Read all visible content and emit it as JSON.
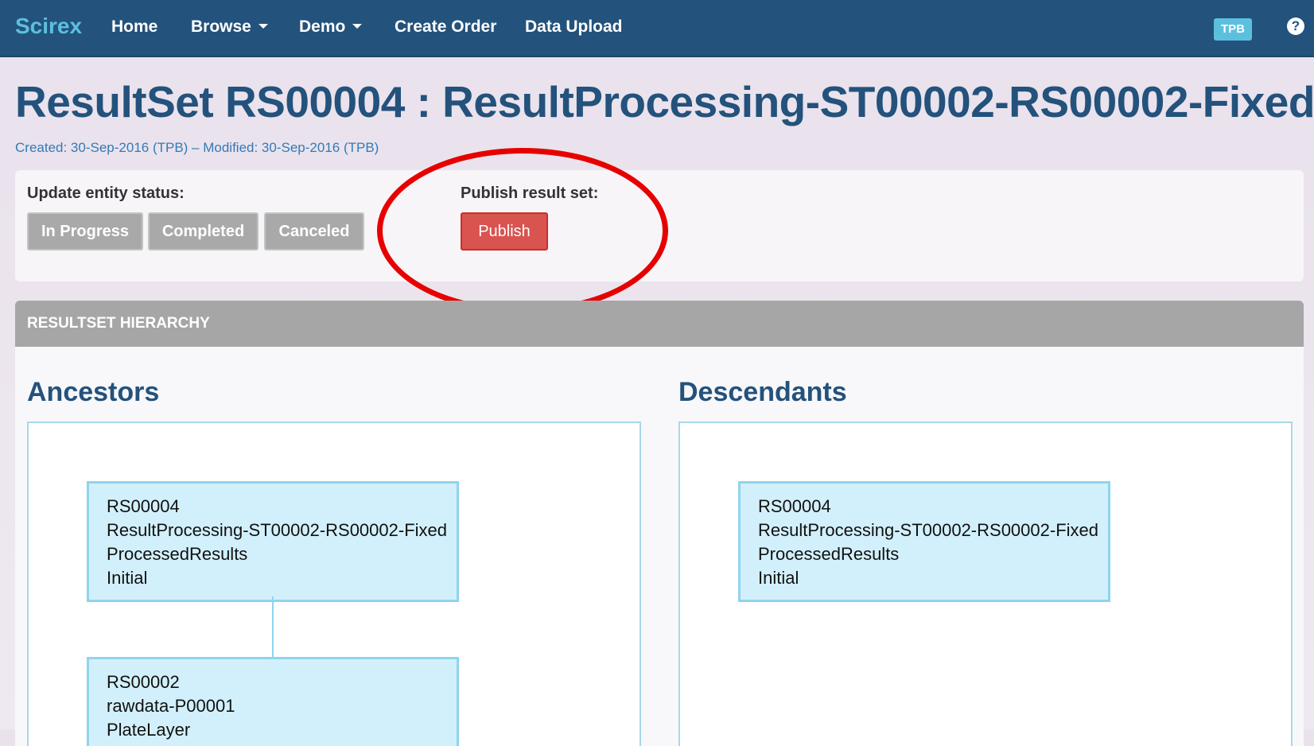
{
  "navbar": {
    "brand": "Scirex",
    "items": [
      {
        "label": "Home"
      },
      {
        "label": "Browse"
      },
      {
        "label": "Demo"
      },
      {
        "label": "Create Order"
      },
      {
        "label": "Data Upload"
      }
    ],
    "user_badge": "TPB",
    "help_glyph": "?"
  },
  "page": {
    "title": "ResultSet RS00004 : ResultProcessing-ST00002-RS00002-Fixed",
    "meta": "Created: 30-Sep-2016 (TPB) – Modified: 30-Sep-2016 (TPB)"
  },
  "status_panel": {
    "update_label": "Update entity status:",
    "buttons": [
      "In Progress",
      "Completed",
      "Canceled"
    ],
    "publish_label": "Publish result set:",
    "publish_button": "Publish"
  },
  "hierarchy": {
    "header": "RESULTSET HIERARCHY",
    "ancestors_title": "Ancestors",
    "descendants_title": "Descendants",
    "ancestors": [
      {
        "id": "RS00004",
        "name": "ResultProcessing-ST00002-RS00002-Fixed",
        "type": "ProcessedResults",
        "status": "Initial"
      },
      {
        "id": "RS00002",
        "name": "rawdata-P00001",
        "type": "PlateLayer",
        "status": ""
      }
    ],
    "descendants": [
      {
        "id": "RS00004",
        "name": "ResultProcessing-ST00002-RS00002-Fixed",
        "type": "ProcessedResults",
        "status": "Initial"
      }
    ]
  },
  "colors": {
    "navbar": "#23527c",
    "brand": "#5bc0de",
    "title": "#23527c",
    "publish": "#d9534f",
    "status_button": "#a9a9a9",
    "node_fill": "#d2f0fb",
    "annotation": "#e60000"
  },
  "icons": {
    "help": "question-circle-icon",
    "dropdown": "caret-down-icon"
  }
}
